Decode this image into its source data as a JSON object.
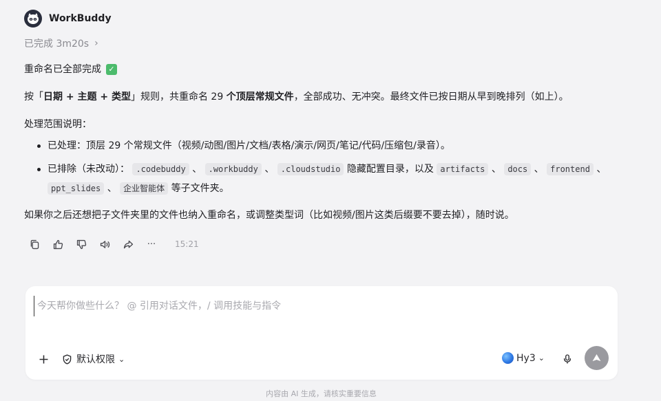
{
  "agent": {
    "name": "WorkBuddy",
    "avatar_icon": "raccoon-logo-icon"
  },
  "status": {
    "text": "已完成 3m20s",
    "chevron": "›"
  },
  "message": {
    "heading": "重命名已全部完成",
    "summary": {
      "pre": "按「",
      "rule": "日期 + 主题 + 类型",
      "mid1": "」规则，共重命名 29 ",
      "bold_count": "个顶层常规文件",
      "rest": "，全部成功、无冲突。最终文件已按日期从早到晚排列（如上）。"
    },
    "scope_title": "处理范围说明：",
    "bullet1": "已处理：顶层 29 个常规文件（视频/动图/图片/文档/表格/演示/网页/笔记/代码/压缩包/录音）。",
    "bullet2": {
      "label": "已排除（未改动）：",
      "code1": ".codebuddy",
      "sep1": "、",
      "code2": ".workbuddy",
      "sep2": "、",
      "code3": ".cloudstudio",
      "mid": " 隐藏配置目录，以及 ",
      "code4": "artifacts",
      "sep3": "、",
      "code5": "docs",
      "sep4": "、",
      "code6": "frontend",
      "sep5": "、",
      "code7": "ppt_slides",
      "sep6": "、",
      "code8": "企业智能体",
      "tail": " 等子文件夹。"
    },
    "followup": "如果你之后还想把子文件夹里的文件也纳入重命名，或调整类型词（比如视频/图片这类后缀要不要去掉），随时说。"
  },
  "actions": {
    "icons": [
      "copy-icon",
      "thumbs-up-icon",
      "thumbs-down-icon",
      "speaker-icon",
      "share-icon",
      "more-icon"
    ],
    "more_label": "···",
    "time": "15:21"
  },
  "composer": {
    "placeholder": "今天帮你做些什么？ @ 引用对话文件，/ 调用技能与指令",
    "permission_label": "默认权限",
    "model_label": "Hy3"
  },
  "disclaimer": "内容由 AI 生成，请核实重要信息",
  "colors": {
    "accent_green": "#4cbb6c",
    "send_button": "#9a9a9f",
    "background": "#f3f3f5"
  }
}
